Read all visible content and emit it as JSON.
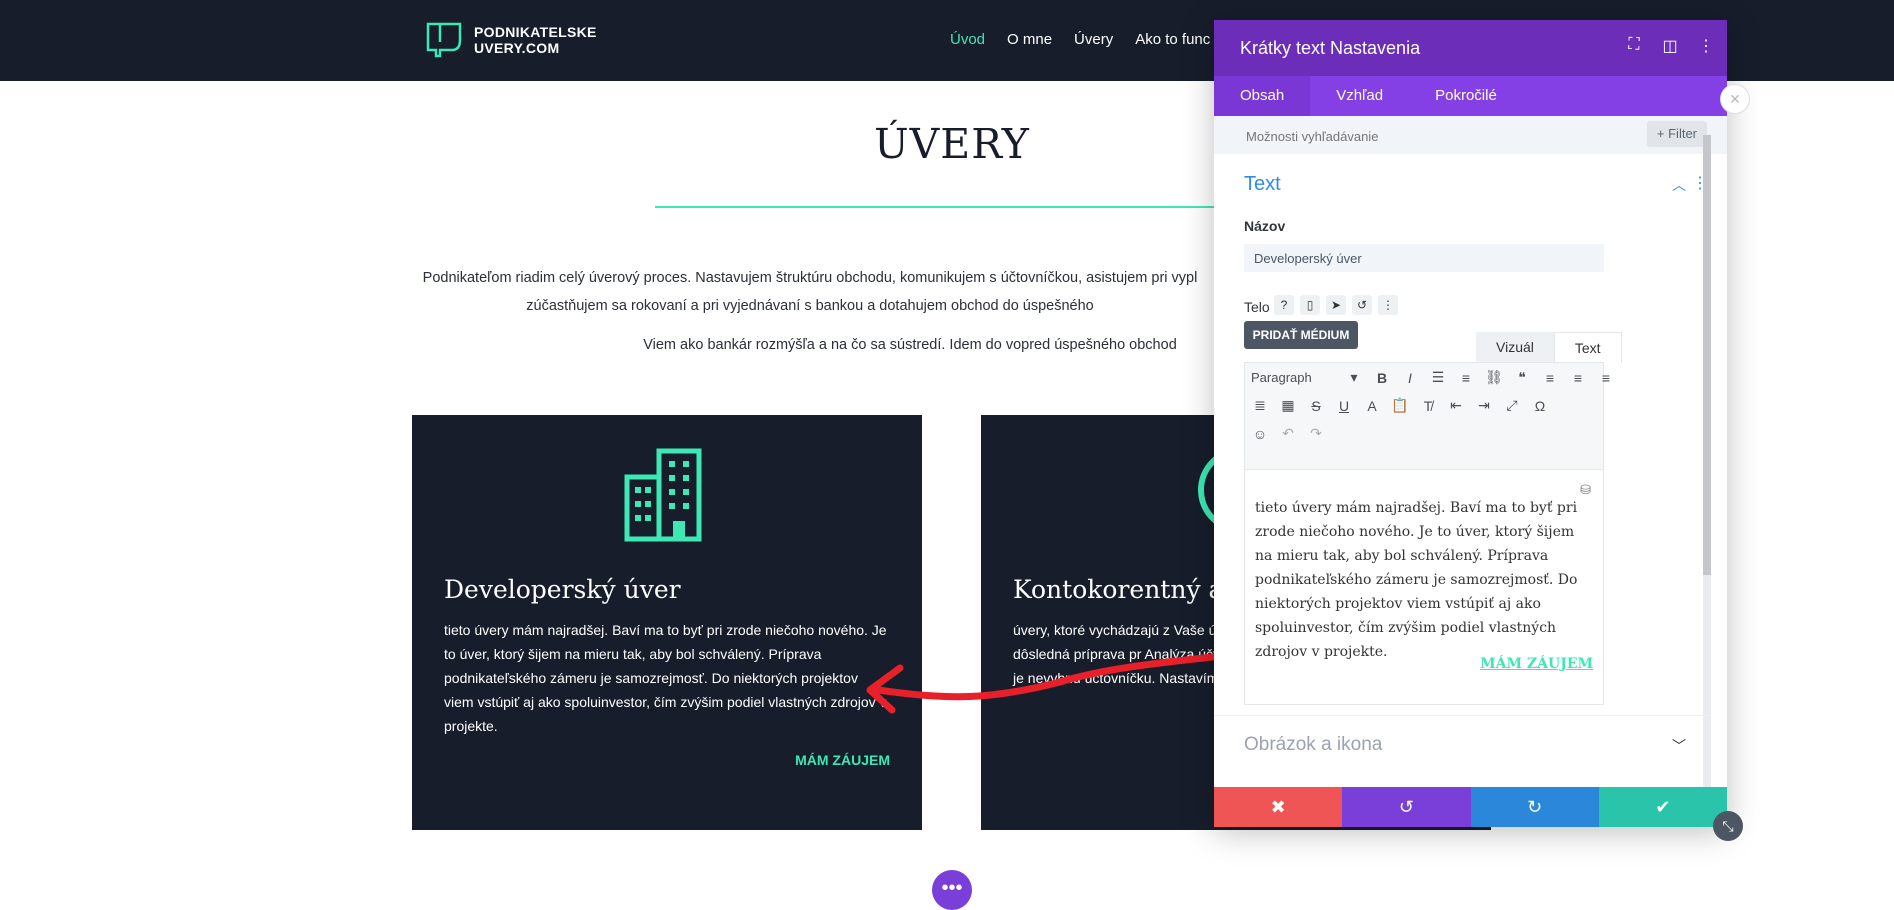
{
  "site": {
    "logo_line1": "PODNIKATELSKE",
    "logo_line2": "UVERY.COM",
    "nav": [
      "Úvod",
      "O mne",
      "Úvery",
      "Ako to func"
    ],
    "accent": "#3ee8b5",
    "header_bg": "#171d2b"
  },
  "main": {
    "title": "ÚVERY",
    "intro_line1": "Podnikateľom riadim celý úverový proces. Nastavujem štruktúru obchodu, komunikujem s účtovníčkou, asistujem pri vypl",
    "intro_line2": "zúčastňujem sa rokovaní a pri vyjednávaní s bankou a dotahujem obchod do úspešného",
    "intro2": "Viem ako bankár rozmýšľa a na čo sa sústredí. Idem do vopred úspešného obchod",
    "cards": [
      {
        "title": "Developerský úver",
        "body": "tieto úvery mám najradšej. Baví ma to byť pri zrode niečoho nového. Je to úver, ktorý šijem na mieru tak, aby bol schválený. Príprava podnikateľského zámeru je samozrejmosť. Do niektorých projektov viem vstúpiť aj ako spoluinvestor, čím zvýšim podiel vlastných zdrojov v projekte.",
        "link": "MÁM ZÁUJEM",
        "icon": "building-icon"
      },
      {
        "title": "Kontokorentný a",
        "body": "úvery, ktoré vychádzajú z Vaše úvery nastavujú na základe úč moja dôsledná príprava pr Analýza účtovnej závierky spol účtovných položiek je nevyhnu účtovníčku. Nastavíme to tak, a",
        "icon": "circle-icon"
      }
    ],
    "fab": "•••"
  },
  "panel": {
    "title": "Krátky text Nastavenia",
    "tabs": [
      "Obsah",
      "Vzhľad",
      "Pokročilé"
    ],
    "search_placeholder": "Možnosti vyhľadávanie",
    "filter_label": "+ Filter",
    "section_title": "Text",
    "name_label": "Názov",
    "name_value": "Developerský úver",
    "body_label": "Telo",
    "media_button": "PRIDAŤ MÉDIUM",
    "editor_tabs": [
      "Vizuál",
      "Text"
    ],
    "paragraph_select": "Paragraph",
    "editor_text": "tieto úvery mám najradšej. Baví ma to byť pri zrode niečoho nového. Je to úver, ktorý šijem na mieru tak, aby bol schválený. Príprava podnikateľského zámeru je samozrejmosť. Do niektorých projektov viem vstúpiť aj ako spoluinvestor, čím zvýšim podiel vlastných zdrojov v projekte.",
    "editor_link": "MÁM ZÁUJEM",
    "section2_title": "Obrázok a ikona",
    "header_color": "#6c2eb9",
    "tab_bar_color": "#8540e5",
    "footer_colors": [
      "#ef5555",
      "#7b3fd9",
      "#2b87da",
      "#29c4a9"
    ]
  }
}
